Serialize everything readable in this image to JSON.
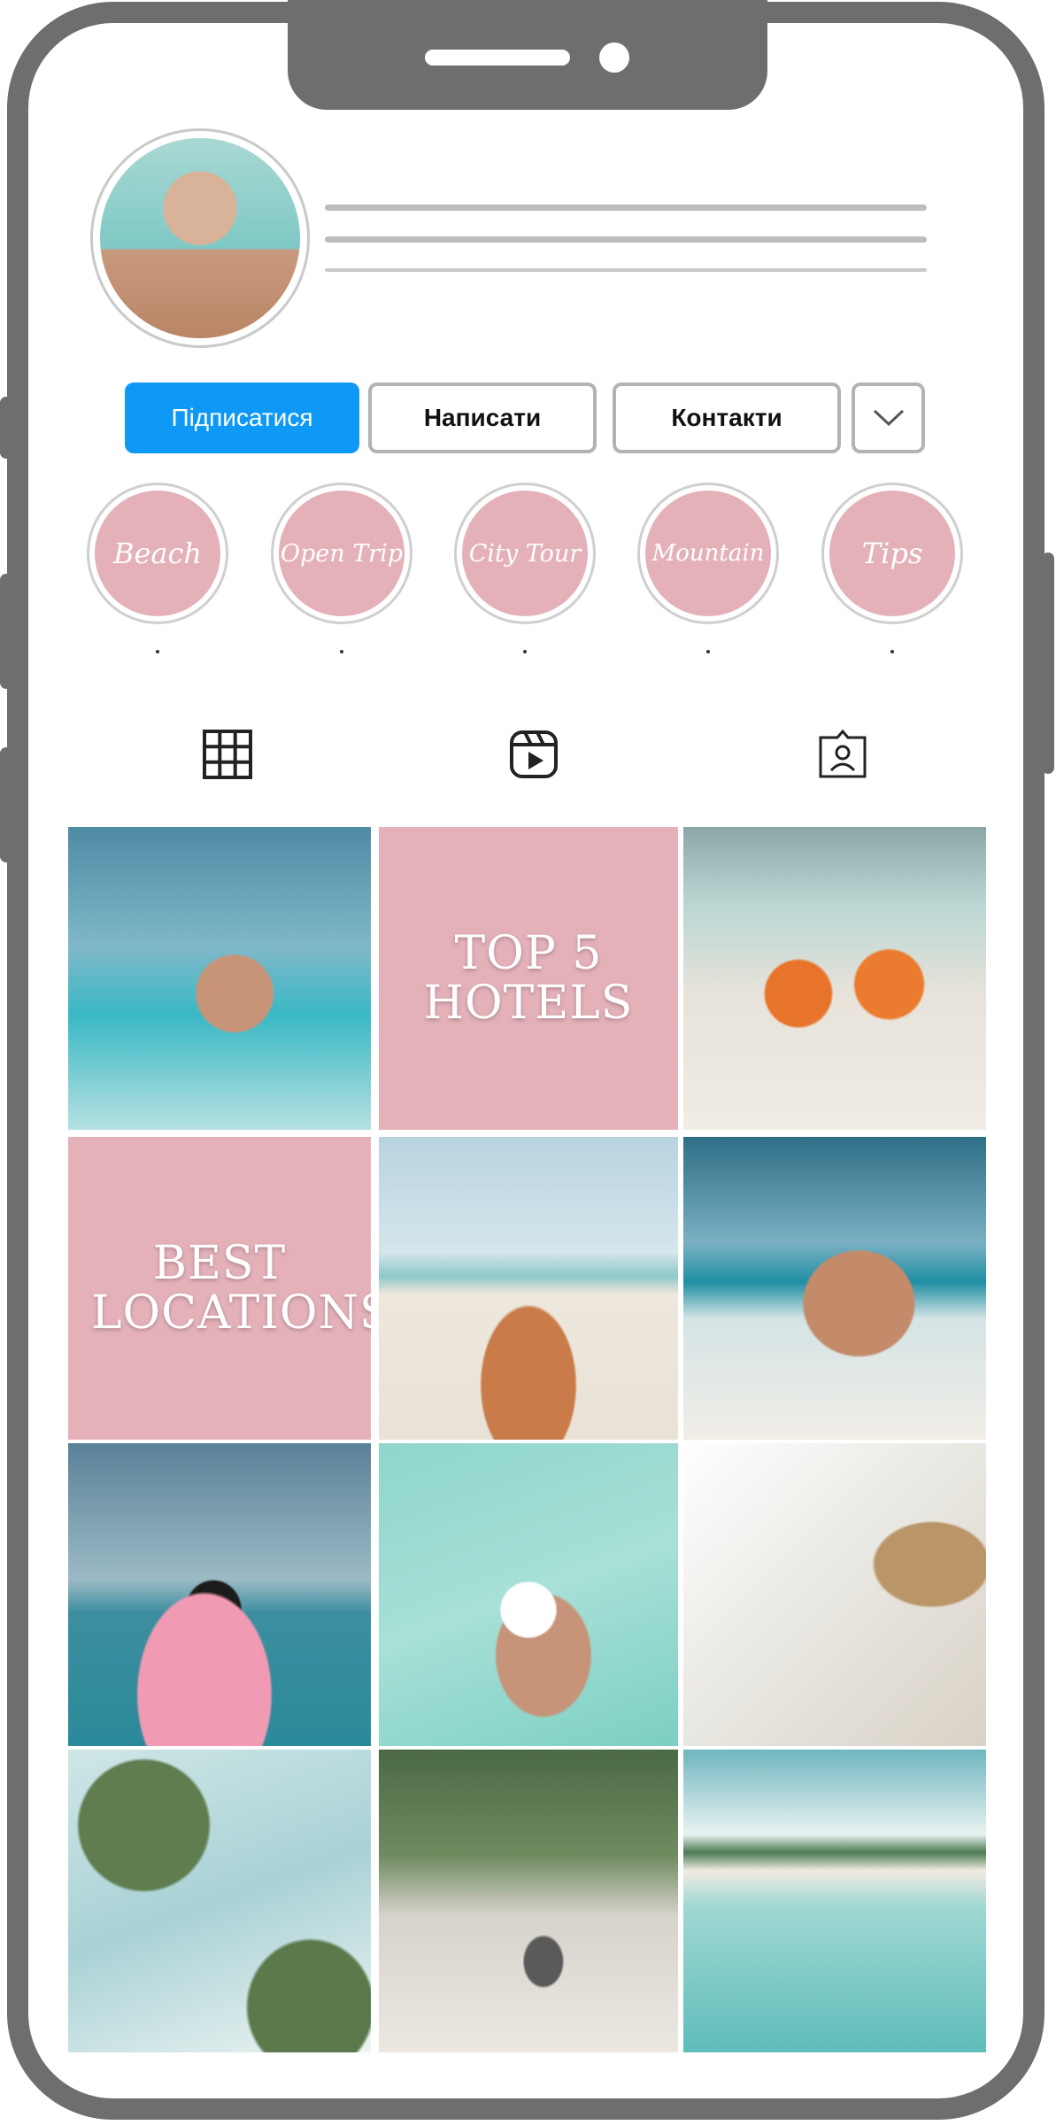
{
  "profile": {
    "avatar_icon": "profile-photo"
  },
  "actions": {
    "follow_label": "Підписатися",
    "message_label": "Написати",
    "contacts_label": "Контакти",
    "more_icon": "chevron-down-icon"
  },
  "highlights": [
    {
      "label": "Beach",
      "caption": "."
    },
    {
      "label": "Open Trip",
      "caption": "."
    },
    {
      "label": "City Tour",
      "caption": "."
    },
    {
      "label": "Mountain",
      "caption": "."
    },
    {
      "label": "Tips",
      "caption": "."
    }
  ],
  "tabs": [
    {
      "icon": "grid-icon"
    },
    {
      "icon": "reels-icon"
    },
    {
      "icon": "tagged-icon"
    }
  ],
  "posts": [
    {
      "type": "photo",
      "subject": "woman in sea"
    },
    {
      "type": "text",
      "text": "TOP 5 HOTELS"
    },
    {
      "type": "photo",
      "subject": "coconut drinks"
    },
    {
      "type": "text",
      "text": "BEST LOCATIONS"
    },
    {
      "type": "photo",
      "subject": "breakfast on beach"
    },
    {
      "type": "photo",
      "subject": "woman sunbathing"
    },
    {
      "type": "photo",
      "subject": "woman on surfboard"
    },
    {
      "type": "photo",
      "subject": "hand with flower in pool"
    },
    {
      "type": "photo",
      "subject": "beach chair"
    },
    {
      "type": "photo",
      "subject": "palm trees sky"
    },
    {
      "type": "photo",
      "subject": "woman with bicycle"
    },
    {
      "type": "photo",
      "subject": "pier lagoon"
    }
  ],
  "colors": {
    "frame": "#6e6e6e",
    "accent_blue": "#0f99f6",
    "highlight_pink": "#e4b1b9",
    "divider_gray": "#bdbdbd"
  }
}
